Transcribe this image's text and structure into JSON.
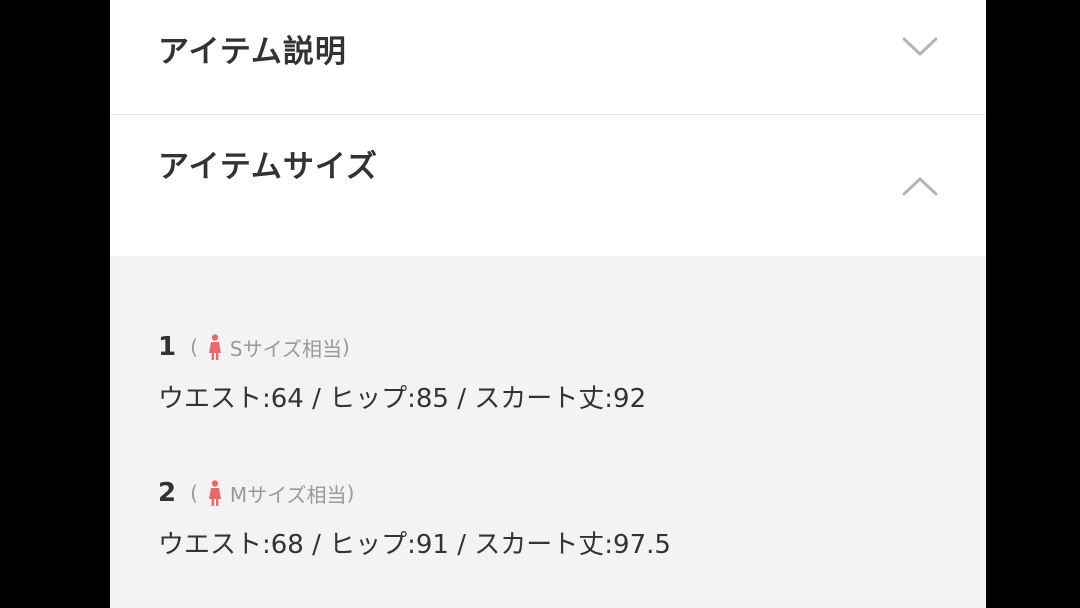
{
  "accordion": [
    {
      "title": "アイテム説明",
      "state": "collapsed",
      "chevron": "chevron-down-icon"
    },
    {
      "title": "アイテムサイズ",
      "state": "expanded",
      "chevron": "chevron-up-icon"
    }
  ],
  "sizes": [
    {
      "number": "1",
      "open_paren": "(",
      "equivalent": "Sサイズ相当",
      "close_paren": ")",
      "measurements": "ウエスト:64 / ヒップ:85 / スカート丈:92"
    },
    {
      "number": "2",
      "open_paren": "(",
      "equivalent": "Mサイズ相当",
      "close_paren": ")",
      "measurements": "ウエスト:68 / ヒップ:91 / スカート丈:97.5"
    }
  ],
  "colors": {
    "accent_icon": "#e86a6a",
    "body_bg": "#f3f3f3",
    "text": "#333333",
    "muted": "#999999"
  }
}
